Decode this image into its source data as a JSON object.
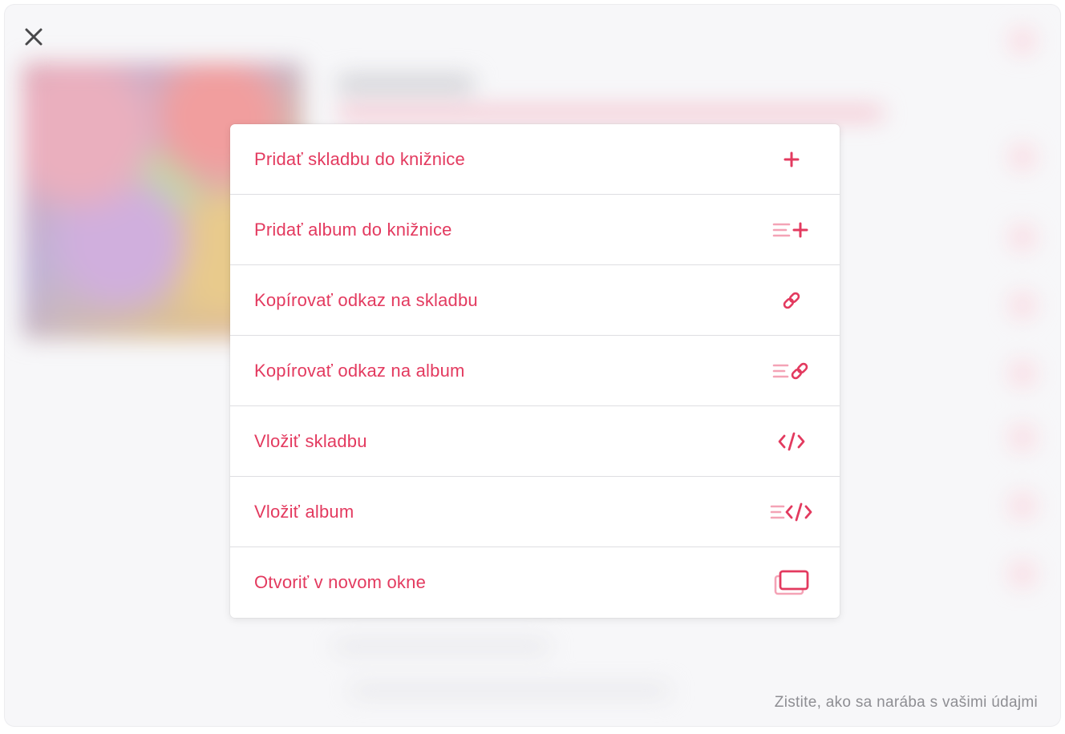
{
  "close": {
    "icon": "close-icon"
  },
  "menu": {
    "items": [
      {
        "label": "Pridať skladbu do knižnice",
        "icon": "plus-icon"
      },
      {
        "label": "Pridať album do knižnice",
        "icon": "list-plus-icon"
      },
      {
        "label": "Kopírovať odkaz na skladbu",
        "icon": "link-icon"
      },
      {
        "label": "Kopírovať odkaz na album",
        "icon": "list-link-icon"
      },
      {
        "label": "Vložiť skladbu",
        "icon": "code-icon"
      },
      {
        "label": "Vložiť album",
        "icon": "list-code-icon"
      },
      {
        "label": "Otvoriť v novom okne",
        "icon": "new-window-icon"
      }
    ]
  },
  "footer": {
    "privacy_link": "Zistite, ako sa narába s vašimi údajmi"
  },
  "colors": {
    "accent": "#e33a5f",
    "accent_light": "#f4a3b6",
    "muted_text": "#8e8e93"
  }
}
